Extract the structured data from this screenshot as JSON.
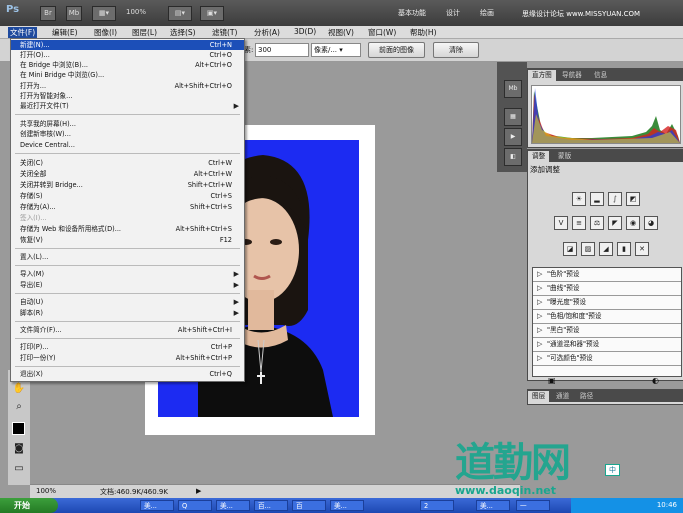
{
  "app": {
    "logo": "Ps",
    "bridge_button": "Br",
    "minibridge_button": "Mb",
    "zoom_display": "100%",
    "workspaces": [
      "基本功能",
      "设计",
      "绘画"
    ],
    "search_watermark": "思缘设计论坛 www.MISSYUAN.COM"
  },
  "menubar": {
    "items": [
      "文件(F)",
      "编辑(E)",
      "图像(I)",
      "图层(L)",
      "选择(S)",
      "滤镜(T)",
      "分析(A)",
      "3D(D)",
      "视图(V)",
      "窗口(W)",
      "帮助(H)"
    ]
  },
  "options": {
    "label": "素:",
    "value": "300",
    "unit": "像素/...",
    "front_image_button": "前面的图像",
    "clear_button": "清除"
  },
  "file_menu": {
    "items": [
      {
        "label": "新建(N)...",
        "shortcut": "Ctrl+N",
        "highlighted": true
      },
      {
        "label": "打开(O)...",
        "shortcut": "Ctrl+O"
      },
      {
        "label": "在 Bridge 中浏览(B)...",
        "shortcut": "Alt+Ctrl+O"
      },
      {
        "label": "在 Mini Bridge 中浏览(G)...",
        "shortcut": ""
      },
      {
        "label": "打开为...",
        "shortcut": "Alt+Shift+Ctrl+O"
      },
      {
        "label": "打开为智能对象...",
        "shortcut": ""
      },
      {
        "label": "最近打开文件(T)",
        "shortcut": "",
        "submenu": true
      },
      {
        "label": "共享我的屏幕(H)...",
        "shortcut": ""
      },
      {
        "label": "创建新审核(W)...",
        "shortcut": ""
      },
      {
        "label": "Device Central...",
        "shortcut": ""
      },
      {
        "label": "关闭(C)",
        "shortcut": "Ctrl+W"
      },
      {
        "label": "关闭全部",
        "shortcut": "Alt+Ctrl+W"
      },
      {
        "label": "关闭并转到 Bridge...",
        "shortcut": "Shift+Ctrl+W"
      },
      {
        "label": "存储(S)",
        "shortcut": "Ctrl+S"
      },
      {
        "label": "存储为(A)...",
        "shortcut": "Shift+Ctrl+S"
      },
      {
        "label": "签入(I)...",
        "shortcut": "",
        "disabled": true
      },
      {
        "label": "存储为 Web 和设备所用格式(D)...",
        "shortcut": "Alt+Shift+Ctrl+S"
      },
      {
        "label": "恢复(V)",
        "shortcut": "F12"
      },
      {
        "label": "置入(L)...",
        "shortcut": ""
      },
      {
        "label": "导入(M)",
        "shortcut": "",
        "submenu": true
      },
      {
        "label": "导出(E)",
        "shortcut": "",
        "submenu": true
      },
      {
        "label": "自动(U)",
        "shortcut": "",
        "submenu": true
      },
      {
        "label": "脚本(R)",
        "shortcut": "",
        "submenu": true
      },
      {
        "label": "文件简介(F)...",
        "shortcut": "Alt+Shift+Ctrl+I"
      },
      {
        "label": "打印(P)...",
        "shortcut": "Ctrl+P"
      },
      {
        "label": "打印一份(Y)",
        "shortcut": "Alt+Shift+Ctrl+P"
      },
      {
        "label": "退出(X)",
        "shortcut": "Ctrl+Q"
      }
    ]
  },
  "histogram_panel": {
    "tabs": [
      "直方图",
      "导航器",
      "信息"
    ]
  },
  "adjustments_panel": {
    "tabs": [
      "调整",
      "蒙版"
    ],
    "title": "添加调整",
    "presets": [
      "\"色阶\"预设",
      "\"曲线\"预设",
      "\"曝光度\"预设",
      "\"色相/饱和度\"预设",
      "\"黑白\"预设",
      "\"通道混和器\"预设",
      "\"可选颜色\"预设"
    ]
  },
  "layers_panel": {
    "tabs": [
      "图层",
      "通道",
      "路径"
    ]
  },
  "statusbar": {
    "zoom": "100%",
    "doc_info": "文档:460.9K/460.9K"
  },
  "taskbar": {
    "start_label": "开始",
    "items": [
      "美...",
      "Q",
      "美...",
      "百...",
      "百",
      "美...",
      "2",
      "美...",
      "一"
    ],
    "tray_text": "10:46"
  },
  "watermark": {
    "logo_text": "道勤网",
    "url": "www.daoqin.net",
    "badge": "中"
  },
  "colors": {
    "photo_background": "#1c2bf2",
    "menu_highlight": "#1c4fb8",
    "watermark": "#1aa68f"
  }
}
